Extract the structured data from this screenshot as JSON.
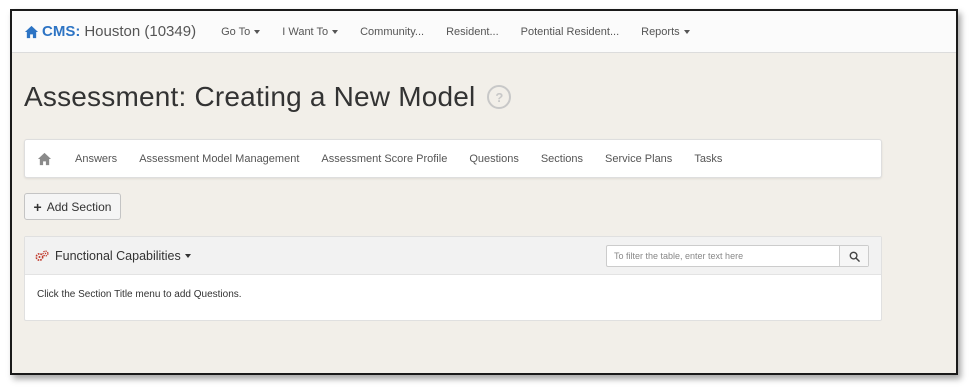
{
  "navbar": {
    "brand_cms": "CMS:",
    "brand_name": "Houston (10349)",
    "items": [
      {
        "label": "Go To",
        "caret": true
      },
      {
        "label": "I Want To",
        "caret": true
      },
      {
        "label": "Community...",
        "caret": false
      },
      {
        "label": "Resident...",
        "caret": false
      },
      {
        "label": "Potential Resident...",
        "caret": false
      },
      {
        "label": "Reports",
        "caret": true
      }
    ]
  },
  "page": {
    "title": "Assessment: Creating a New Model",
    "help_icon_text": "?"
  },
  "subnav": {
    "items": [
      "Answers",
      "Assessment Model Management",
      "Assessment Score Profile",
      "Questions",
      "Sections",
      "Service Plans",
      "Tasks"
    ]
  },
  "add_section": {
    "label": "Add Section"
  },
  "panel": {
    "title": "Functional Capabilities",
    "filter_placeholder": "To filter the table, enter text here",
    "body_text": "Click the Section Title menu to add Questions."
  },
  "colors": {
    "brand": "#2d74c4",
    "page_background": "#f2efe9",
    "navbar_background": "#fbfbfb"
  },
  "icons": {
    "brand": "home-icon",
    "help": "question-circle-icon",
    "subnav_home": "home-icon",
    "add": "plus-icon",
    "panel": "cogs-icon",
    "filter": "search-icon"
  }
}
